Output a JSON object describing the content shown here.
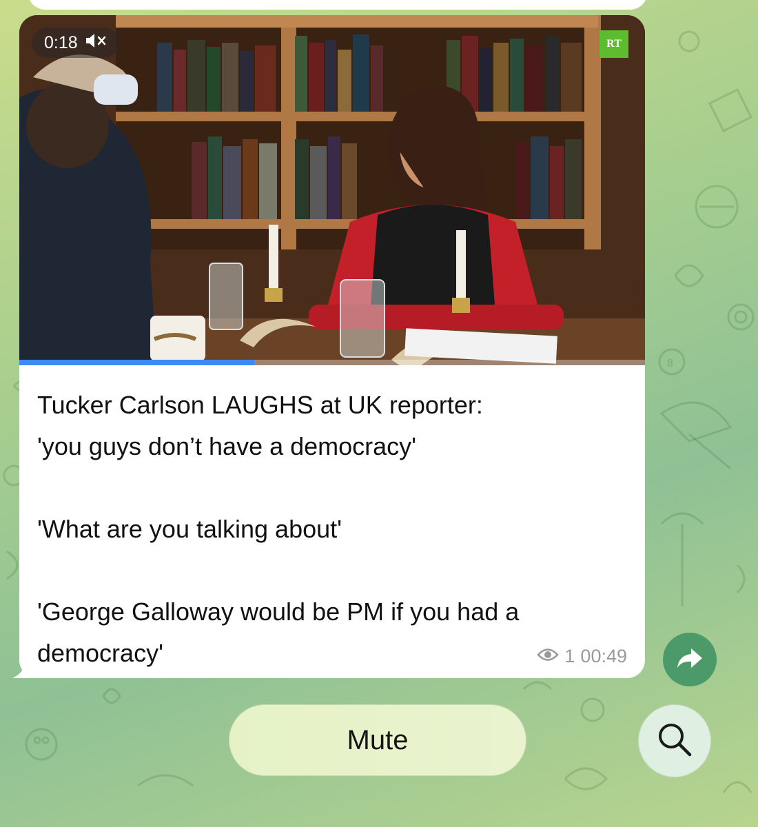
{
  "video": {
    "duration": "0:18",
    "channel_logo": "RT",
    "progress": 0.375,
    "muted_icon": "speaker-muted-icon"
  },
  "caption": "Tucker Carlson LAUGHS at UK reporter:\n'you guys don’t have a democracy'\n\n'What are you talking about'\n\n'George Galloway would be PM if you had a democracy'",
  "meta": {
    "views": "1",
    "time": "00:49",
    "views_icon": "eye-icon"
  },
  "actions": {
    "share_icon": "share-arrow-icon",
    "mute_label": "Mute",
    "search_icon": "search-icon"
  },
  "colors": {
    "accent": "#3d8af7",
    "share_button": "#4c9a69",
    "rt_green": "#5dbb2e"
  }
}
